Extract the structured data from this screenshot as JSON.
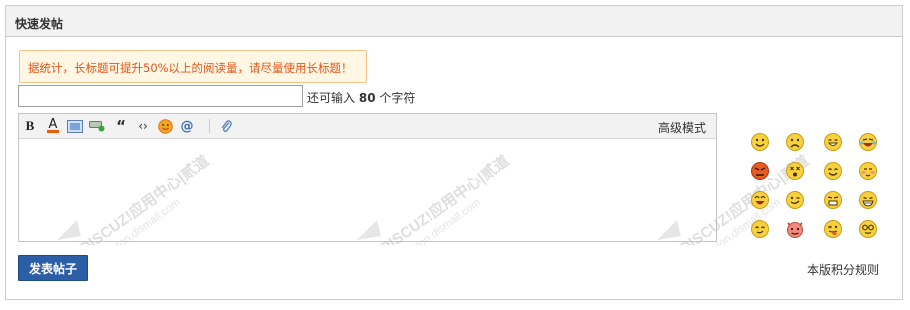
{
  "panel": {
    "title": "快速发帖"
  },
  "notice": {
    "text": "据统计，长标题可提升50%以上的阅读量，请尽量使用长标题！"
  },
  "subject": {
    "value": "",
    "counter_prefix": "还可输入",
    "counter_value": "80",
    "counter_suffix": "个字符"
  },
  "editor": {
    "advanced_mode_label": "高级模式",
    "toolbar": [
      {
        "name": "bold-button",
        "icon": "bold-icon"
      },
      {
        "name": "font-color-button",
        "icon": "font-color-icon"
      },
      {
        "name": "insert-image-button",
        "icon": "image-icon"
      },
      {
        "name": "insert-link-button",
        "icon": "link-icon"
      },
      {
        "name": "quote-button",
        "icon": "quote-icon"
      },
      {
        "name": "code-button",
        "icon": "code-icon"
      },
      {
        "name": "smiley-button",
        "icon": "smiley-icon"
      },
      {
        "name": "at-button",
        "icon": "at-icon"
      },
      {
        "name": "attachment-button",
        "icon": "paperclip-icon"
      }
    ],
    "content": ""
  },
  "watermark": {
    "text_brand": "DISCUZ!应用中心|贰道",
    "text_site": "addon.dismall.com"
  },
  "smilies": [
    "smile-icon",
    "sad-icon",
    "grin-icon",
    "crying-laugh-icon",
    "angry-icon",
    "dizzy-icon",
    "happy-icon",
    "shy-icon",
    "laughing-icon",
    "wink-icon",
    "scared-icon",
    "big-grin-icon",
    "smirk-icon",
    "devil-icon",
    "tongue-icon",
    "nerd-icon"
  ],
  "actions": {
    "post_label": "发表帖子",
    "rules_label": "本版积分规则"
  },
  "colors": {
    "accent": "#2b5ea6",
    "notice_text": "#e2571b",
    "notice_bg": "#fff6e3",
    "notice_border": "#f2c38a"
  }
}
